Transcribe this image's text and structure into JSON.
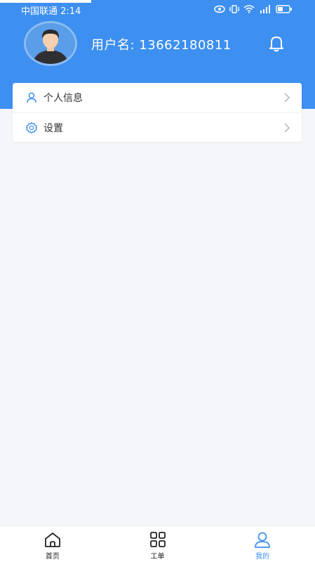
{
  "status_bar": {
    "carrier_time": "中国联通 2:14"
  },
  "profile": {
    "username_label": "用户名: 13662180811"
  },
  "menu": {
    "items": [
      {
        "label": "个人信息",
        "icon": "user-icon"
      },
      {
        "label": "设置",
        "icon": "gear-icon"
      }
    ]
  },
  "tabbar": {
    "tabs": [
      {
        "label": "首页",
        "icon": "home-icon",
        "active": false
      },
      {
        "label": "工单",
        "icon": "grid-icon",
        "active": false
      },
      {
        "label": "我的",
        "icon": "user-icon",
        "active": true
      }
    ]
  },
  "colors": {
    "primary": "#3d8ff0",
    "background": "#f4f6f9",
    "card": "#ffffff",
    "text": "#333333"
  }
}
